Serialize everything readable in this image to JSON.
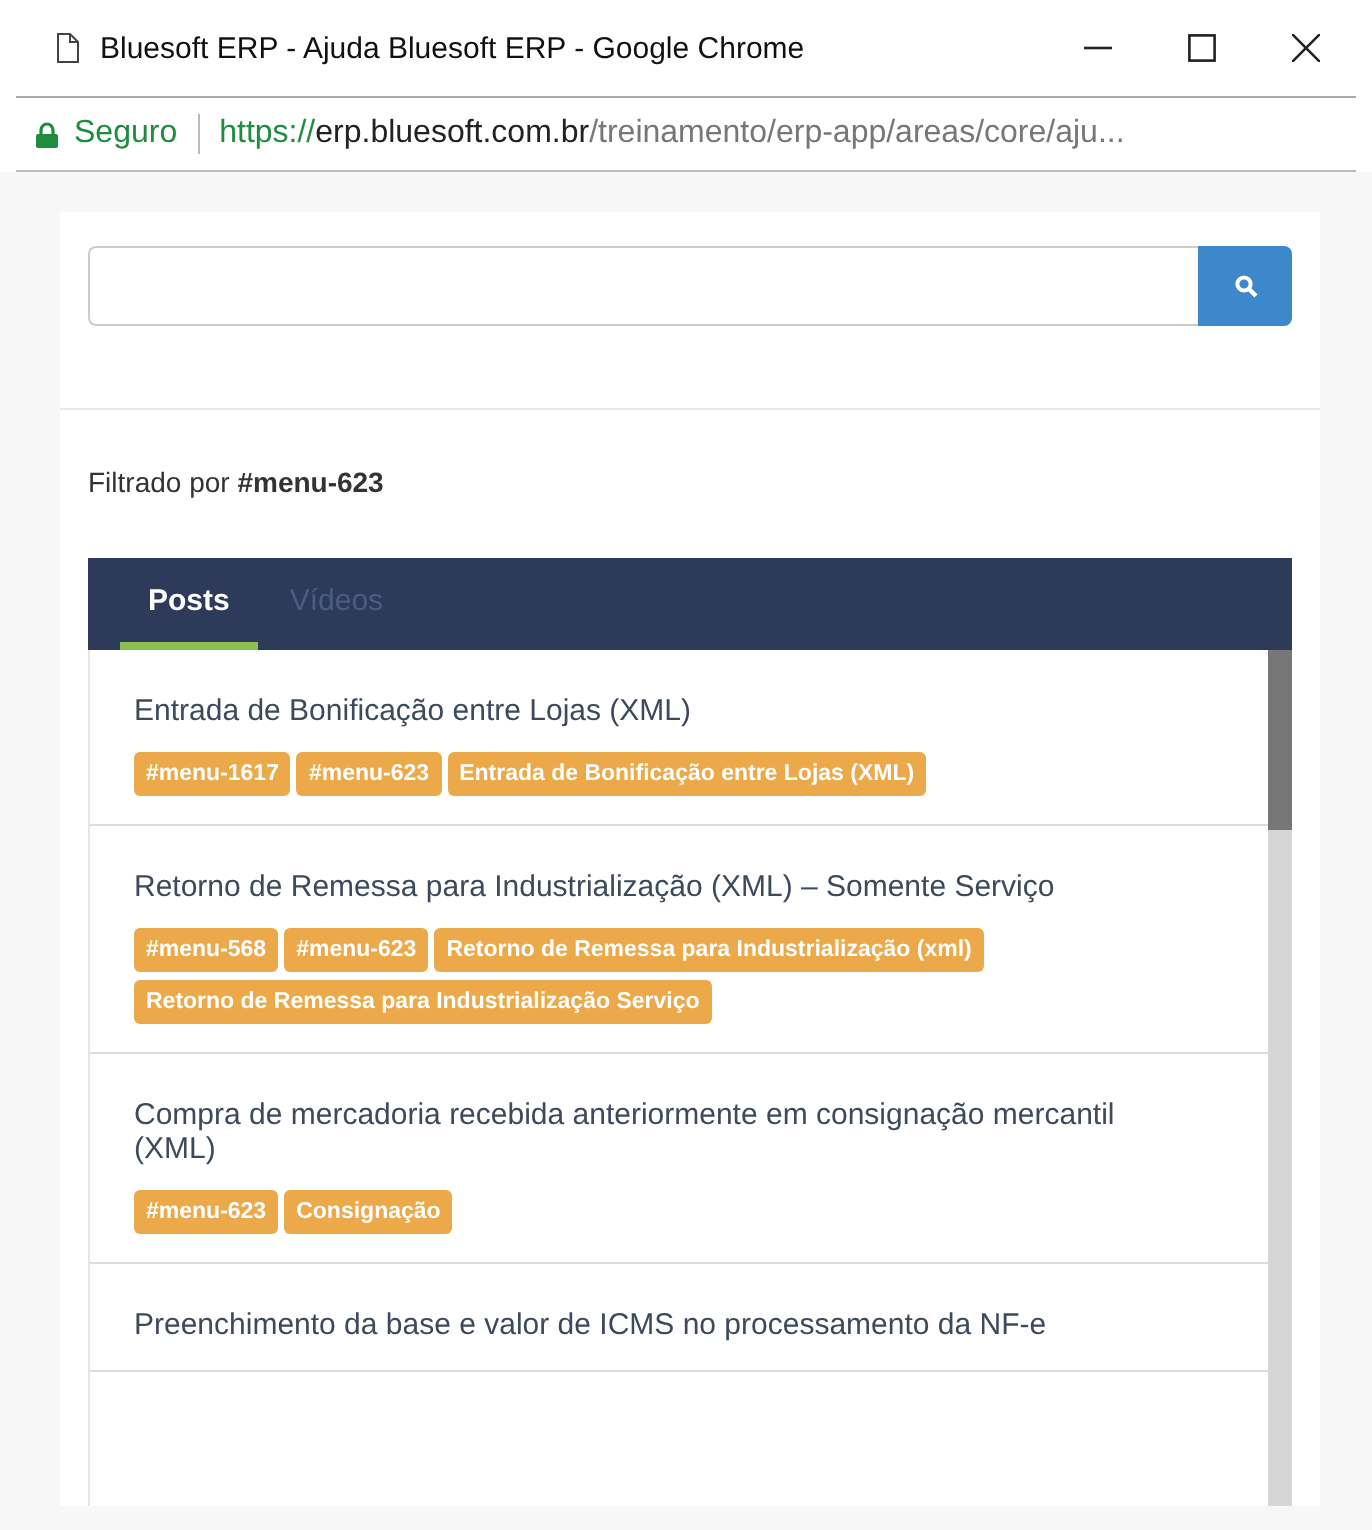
{
  "window": {
    "title": "Bluesoft ERP - Ajuda Bluesoft ERP - Google Chrome"
  },
  "address_bar": {
    "security": "Seguro",
    "url_scheme": "https://",
    "url_host": "erp.bluesoft.com.br",
    "url_path": "/treinamento/erp-app/areas/core/aju..."
  },
  "filter": "Filtrado por **#menu-623**",
  "tabs": [
    {
      "label": "Posts",
      "selected": true
    },
    {
      "label": "Vídeos",
      "selected": false
    }
  ],
  "posts": [
    {
      "title": "Entrada de Bonificação entre Lojas (XML)",
      "tags": [
        "#menu-1617",
        "#menu-623",
        "Entrada de Bonificação entre Lojas (XML)"
      ]
    },
    {
      "title": "Retorno de Remessa para Industrialização (XML) – Somente Serviço",
      "tags": [
        "#menu-568",
        "#menu-623",
        "Retorno de Remessa para Industrialização (xml)",
        "Retorno de Remessa para Industrialização Serviço"
      ]
    },
    {
      "title": "Compra de mercadoria recebida anteriormente em consignação mercantil (XML)",
      "tags": [
        "#menu-623",
        "Consignação"
      ]
    },
    {
      "title": "Preenchimento da base e valor de ICMS no processamento da NF-e"
    }
  ]
}
